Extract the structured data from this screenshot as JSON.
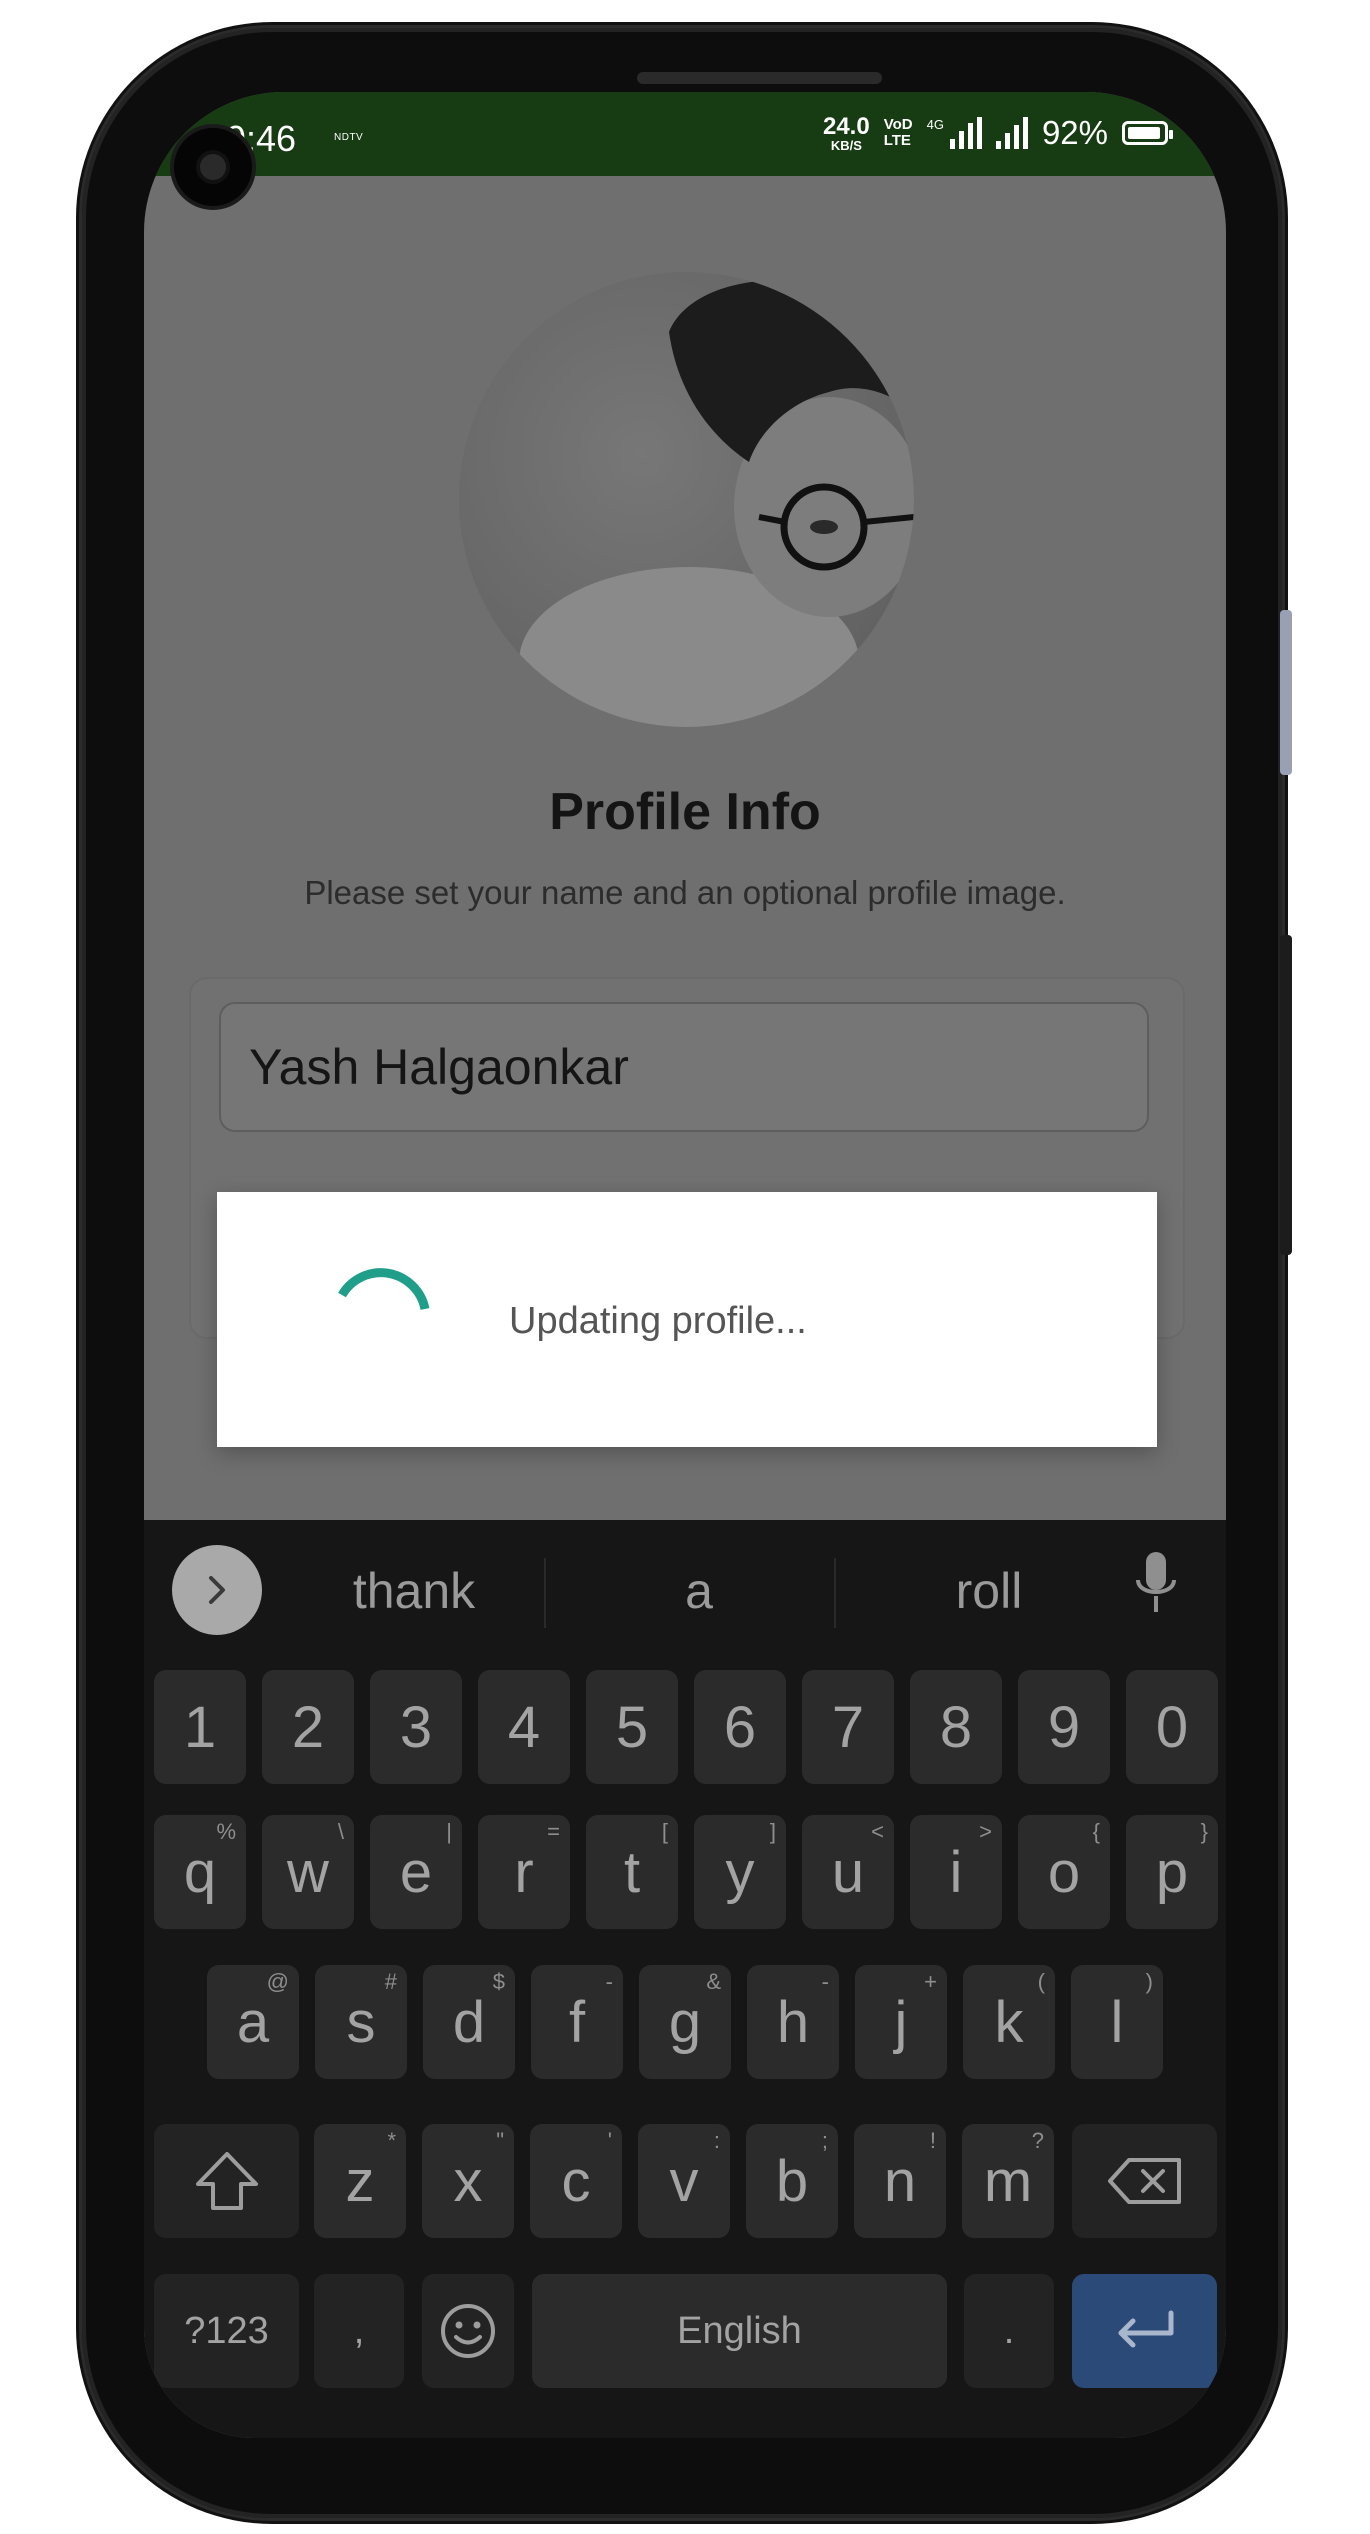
{
  "status_bar": {
    "time": "9:46",
    "notification": "NDTV",
    "net_speed_value": "24.0",
    "net_speed_unit": "KB/S",
    "volte_top": "VoD",
    "volte_bottom": "LTE",
    "network": "4G",
    "battery": "92%"
  },
  "profile": {
    "title": "Profile Info",
    "subtitle": "Please set your name and an optional profile image.",
    "name_value": "Yash Halgaonkar"
  },
  "dialog": {
    "message": "Updating profile..."
  },
  "keyboard": {
    "suggestions": [
      "thank",
      "a",
      "roll"
    ],
    "number_row": [
      "1",
      "2",
      "3",
      "4",
      "5",
      "6",
      "7",
      "8",
      "9",
      "0"
    ],
    "row1": [
      {
        "k": "q",
        "s": "%"
      },
      {
        "k": "w",
        "s": "\\"
      },
      {
        "k": "e",
        "s": "|"
      },
      {
        "k": "r",
        "s": "="
      },
      {
        "k": "t",
        "s": "["
      },
      {
        "k": "y",
        "s": "]"
      },
      {
        "k": "u",
        "s": "<"
      },
      {
        "k": "i",
        "s": ">"
      },
      {
        "k": "o",
        "s": "{"
      },
      {
        "k": "p",
        "s": "}"
      }
    ],
    "row2": [
      {
        "k": "a",
        "s": "@"
      },
      {
        "k": "s",
        "s": "#"
      },
      {
        "k": "d",
        "s": "$"
      },
      {
        "k": "f",
        "s": "-"
      },
      {
        "k": "g",
        "s": "&"
      },
      {
        "k": "h",
        "s": "-"
      },
      {
        "k": "j",
        "s": "+"
      },
      {
        "k": "k",
        "s": "("
      },
      {
        "k": "l",
        "s": ")"
      }
    ],
    "row3": [
      {
        "k": "z",
        "s": "*"
      },
      {
        "k": "x",
        "s": "\""
      },
      {
        "k": "c",
        "s": "'"
      },
      {
        "k": "v",
        "s": ":"
      },
      {
        "k": "b",
        "s": ";"
      },
      {
        "k": "n",
        "s": "!"
      },
      {
        "k": "m",
        "s": "?"
      }
    ],
    "symbols_label": "?123",
    "comma": ",",
    "space_label": "English",
    "period": "."
  },
  "colors": {
    "status_bar_bg": "#173b12",
    "spinner": "#1f9e8a",
    "enter_key": "#2c4a78"
  }
}
